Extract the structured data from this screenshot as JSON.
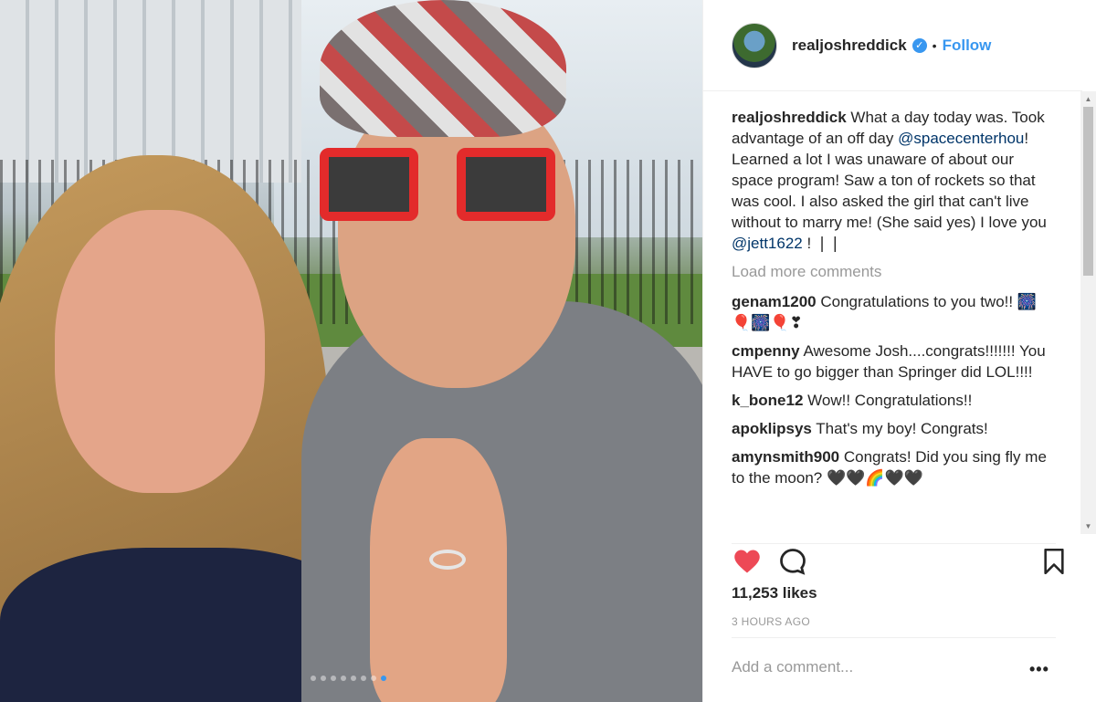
{
  "post": {
    "username": "realjoshreddick",
    "follow_label": "Follow",
    "separator": "•",
    "verified_icon": "verified-badge-icon",
    "carousel": {
      "total": 8,
      "active_index": 7
    }
  },
  "caption": {
    "username": "realjoshreddick",
    "text_1": "What a day today was. Took advantage of an off day ",
    "mention_1": "@spacecenterhou",
    "text_2": "! Learned a lot I was unaware of about our space program! Saw a ton of rockets so that was cool. I also asked the girl that can't live without to marry me! (She said yes) I love you ",
    "mention_2": "@jett1622",
    "text_3": " ! ❘❘"
  },
  "load_more": "Load more comments",
  "comments": [
    {
      "username": "genam1200",
      "text": "Congratulations to you two!! 🎆🎈🎆🎈❣"
    },
    {
      "username": "cmpenny",
      "text": "Awesome Josh....congrats!!!!!!! You HAVE to go bigger than Springer did LOL!!!!"
    },
    {
      "username": "k_bone12",
      "text": "Wow!! Congratulations!!"
    },
    {
      "username": "apoklipsys",
      "text": "That's my boy! Congrats!"
    },
    {
      "username": "amynsmith900",
      "text": "Congrats! Did you sing fly me to the moon? 🖤🖤🌈🖤🖤"
    }
  ],
  "stats": {
    "likes": "11,253 likes",
    "time": "3 HOURS AGO"
  },
  "composer": {
    "placeholder": "Add a comment...",
    "more": "•••"
  },
  "colors": {
    "accent": "#3897f0",
    "heart": "#ed4956",
    "text": "#262626",
    "muted": "#999999"
  },
  "icons": {
    "like": "heart-icon",
    "comment": "comment-bubble-icon",
    "save": "bookmark-icon"
  }
}
